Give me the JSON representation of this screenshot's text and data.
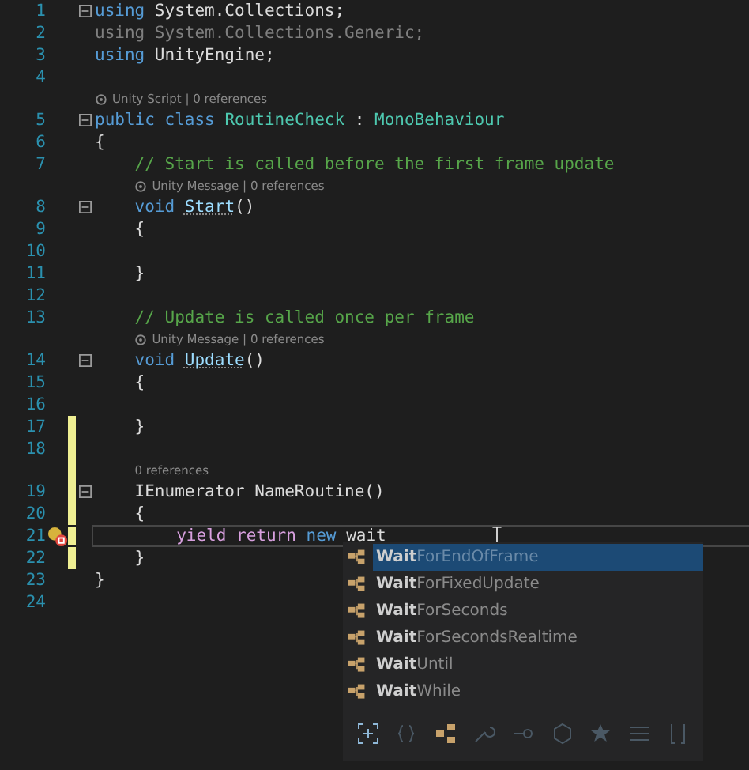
{
  "editor": {
    "lines": [
      {
        "number": "1",
        "fold": true,
        "modified": false,
        "current": false,
        "tokens": [
          {
            "text": "using",
            "kind": "keyword"
          },
          {
            "text": " System.Collections;",
            "kind": "plain"
          }
        ]
      },
      {
        "number": "2",
        "fold": false,
        "modified": false,
        "current": false,
        "tokens": [
          {
            "text": "using System.Collections.Generic;",
            "kind": "dim"
          }
        ]
      },
      {
        "number": "3",
        "fold": false,
        "modified": false,
        "current": false,
        "tokens": [
          {
            "text": "using",
            "kind": "keyword"
          },
          {
            "text": " UnityEngine;",
            "kind": "plain"
          }
        ]
      },
      {
        "number": "4",
        "fold": false,
        "modified": false,
        "current": false
      },
      {
        "number": "5",
        "fold": true,
        "modified": false,
        "current": false,
        "lens": {
          "text": "Unity Script | 0 references",
          "icon": true
        },
        "tokens": [
          {
            "text": "public class ",
            "kind": "keyword"
          },
          {
            "text": "RoutineCheck",
            "kind": "type"
          },
          {
            "text": " : ",
            "kind": "plain"
          },
          {
            "text": "MonoBehaviour",
            "kind": "type"
          }
        ]
      },
      {
        "number": "6",
        "fold": false,
        "modified": false,
        "current": false,
        "tokens": [
          {
            "text": "{",
            "kind": "plain"
          }
        ]
      },
      {
        "number": "7",
        "fold": false,
        "modified": false,
        "current": false,
        "tokens": [
          {
            "text": "    // Start is called before the first frame update",
            "kind": "comment"
          }
        ]
      },
      {
        "number": "8",
        "fold": true,
        "modified": false,
        "current": false,
        "lens": {
          "text": "Unity Message | 0 references",
          "icon": true
        },
        "tokens": [
          {
            "text": "    void ",
            "kind": "keyword"
          },
          {
            "text": "Start",
            "kind": "message"
          },
          {
            "text": "()",
            "kind": "plain"
          }
        ]
      },
      {
        "number": "9",
        "fold": false,
        "modified": false,
        "current": false,
        "tokens": [
          {
            "text": "    {",
            "kind": "plain"
          }
        ]
      },
      {
        "number": "10",
        "fold": false,
        "modified": false,
        "current": false
      },
      {
        "number": "11",
        "fold": false,
        "modified": false,
        "current": false,
        "tokens": [
          {
            "text": "    }",
            "kind": "plain"
          }
        ]
      },
      {
        "number": "12",
        "fold": false,
        "modified": false,
        "current": false
      },
      {
        "number": "13",
        "fold": false,
        "modified": false,
        "current": false,
        "tokens": [
          {
            "text": "    // Update is called once per frame",
            "kind": "comment"
          }
        ]
      },
      {
        "number": "14",
        "fold": true,
        "modified": false,
        "current": false,
        "lens": {
          "text": "Unity Message | 0 references",
          "icon": true
        },
        "tokens": [
          {
            "text": "    void ",
            "kind": "keyword"
          },
          {
            "text": "Update",
            "kind": "message"
          },
          {
            "text": "()",
            "kind": "plain"
          }
        ]
      },
      {
        "number": "15",
        "fold": false,
        "modified": false,
        "current": false,
        "tokens": [
          {
            "text": "    {",
            "kind": "plain"
          }
        ]
      },
      {
        "number": "16",
        "fold": false,
        "modified": false,
        "current": false
      },
      {
        "number": "17",
        "fold": false,
        "modified": true,
        "current": false,
        "tokens": [
          {
            "text": "    }",
            "kind": "plain"
          }
        ]
      },
      {
        "number": "18",
        "fold": false,
        "modified": true,
        "current": false
      },
      {
        "number": "19",
        "fold": true,
        "modified": true,
        "current": false,
        "lens": {
          "text": "0 references",
          "icon": false
        },
        "tokens": [
          {
            "text": "    IEnumerator NameRoutine()",
            "kind": "plain"
          }
        ]
      },
      {
        "number": "20",
        "fold": false,
        "modified": true,
        "current": false,
        "tokens": [
          {
            "text": "    {",
            "kind": "plain"
          }
        ]
      },
      {
        "number": "21",
        "fold": false,
        "modified": true,
        "current": true,
        "tokens": [
          {
            "text": "        yield return ",
            "kind": "control"
          },
          {
            "text": "new ",
            "kind": "keyword"
          },
          {
            "text": "wait",
            "kind": "error"
          }
        ]
      },
      {
        "number": "22",
        "fold": false,
        "modified": true,
        "current": false,
        "tokens": [
          {
            "text": "    }",
            "kind": "plain"
          }
        ]
      },
      {
        "number": "23",
        "fold": false,
        "modified": false,
        "current": false,
        "tokens": [
          {
            "text": "}",
            "kind": "plain"
          }
        ]
      },
      {
        "number": "24",
        "fold": false,
        "modified": false,
        "current": false
      }
    ]
  },
  "completion": {
    "items": [
      {
        "label": "**Wait**ForEndOfFrame",
        "selected": true
      },
      {
        "label": "**Wait**ForFixedUpdate",
        "selected": false
      },
      {
        "label": "**Wait**ForSeconds",
        "selected": false
      },
      {
        "label": "**Wait**ForSecondsRealtime",
        "selected": false
      },
      {
        "label": "**Wait**Until",
        "selected": false
      },
      {
        "label": "**Wait**While",
        "selected": false
      }
    ],
    "filters": [
      {
        "kind": "expand",
        "on": true
      },
      {
        "kind": "braces",
        "on": false
      },
      {
        "kind": "class",
        "on": true
      },
      {
        "kind": "wrench",
        "on": false
      },
      {
        "kind": "key",
        "on": false
      },
      {
        "kind": "cube",
        "on": false
      },
      {
        "kind": "star",
        "on": false
      },
      {
        "kind": "list",
        "on": false
      },
      {
        "kind": "bracket",
        "on": false
      }
    ]
  }
}
